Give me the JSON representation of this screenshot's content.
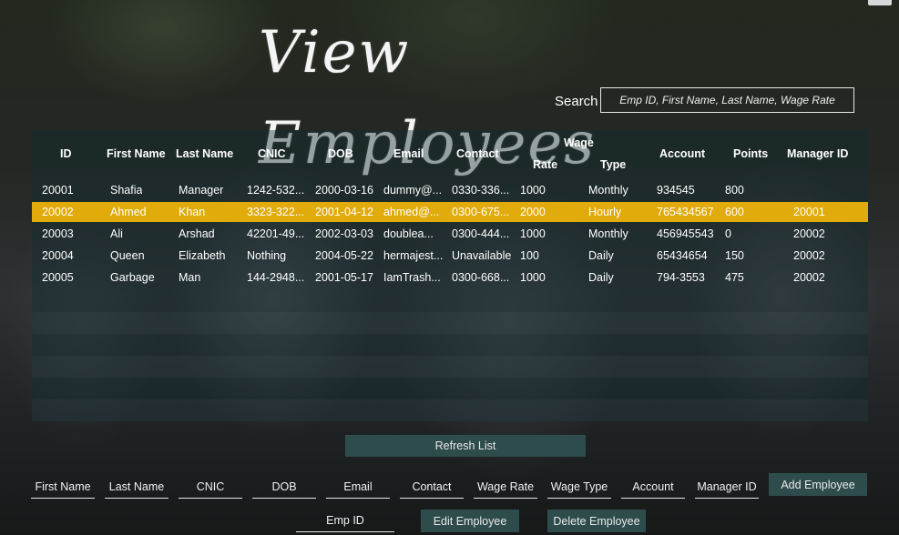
{
  "page": {
    "title": "View Employees"
  },
  "search": {
    "label": "Search",
    "placeholder": "Emp ID, First Name, Last Name, Wage Rate"
  },
  "table": {
    "headers": {
      "id": "ID",
      "first_name": "First Name",
      "last_name": "Last Name",
      "cnic": "CNIC",
      "dob": "DOB",
      "email": "Email",
      "contact": "Contact",
      "wage": "Wage",
      "rate": "Rate",
      "type": "Type",
      "account": "Account",
      "points": "Points",
      "manager_id": "Manager ID"
    },
    "rows": [
      {
        "id": "20001",
        "first_name": "Shafia",
        "last_name": "Manager",
        "cnic": "1242-532...",
        "dob": "2000-03-16",
        "email": "dummy@...",
        "contact": "0330-336...",
        "rate": "1000",
        "type": "Monthly",
        "account": "934545",
        "points": "800",
        "manager_id": ""
      },
      {
        "id": "20002",
        "first_name": "Ahmed",
        "last_name": "Khan",
        "cnic": "3323-322...",
        "dob": "2001-04-12",
        "email": "ahmed@...",
        "contact": "0300-675...",
        "rate": "2000",
        "type": "Hourly",
        "account": "765434567",
        "points": "600",
        "manager_id": "20001"
      },
      {
        "id": "20003",
        "first_name": "Ali",
        "last_name": "Arshad",
        "cnic": "42201-49...",
        "dob": "2002-03-03",
        "email": "doublea...",
        "contact": "0300-444...",
        "rate": "1000",
        "type": "Monthly",
        "account": "456945543",
        "points": "0",
        "manager_id": "20002"
      },
      {
        "id": "20004",
        "first_name": "Queen",
        "last_name": "Elizabeth",
        "cnic": "Nothing",
        "dob": "2004-05-22",
        "email": "hermajest...",
        "contact": "Unavailable",
        "rate": "100",
        "type": "Daily",
        "account": "65434654",
        "points": "150",
        "manager_id": "20002"
      },
      {
        "id": "20005",
        "first_name": "Garbage",
        "last_name": "Man",
        "cnic": "144-2948...",
        "dob": "2001-05-17",
        "email": "IamTrash...",
        "contact": "0300-668...",
        "rate": "1000",
        "type": "Daily",
        "account": "794-3553",
        "points": "475",
        "manager_id": "20002"
      }
    ]
  },
  "buttons": {
    "refresh": "Refresh List",
    "add": "Add Employee",
    "edit": "Edit Employee",
    "delete": "Delete Employee"
  },
  "fields": {
    "first_name": "First Name",
    "last_name": "Last Name",
    "cnic": "CNIC",
    "dob": "DOB",
    "email": "Email",
    "contact": "Contact",
    "wage_rate": "Wage Rate",
    "wage_type": "Wage Type",
    "account": "Account",
    "manager_id": "Manager ID",
    "emp_id": "Emp ID"
  },
  "colors": {
    "selected_row": "#e0ab0b",
    "button_bg": "#2f4c4d"
  }
}
